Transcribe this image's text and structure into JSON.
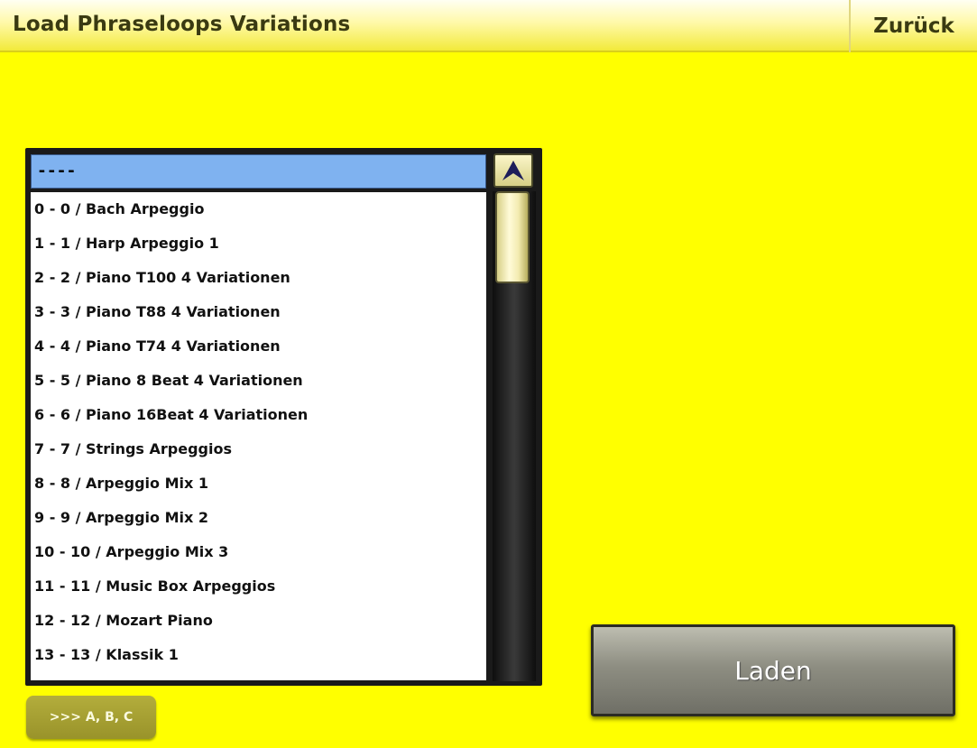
{
  "window": {
    "title": "Load Phraseloops Variations",
    "back_label": "Zurück"
  },
  "list": {
    "selected_value": "----",
    "items": [
      "0 - 0 / Bach Arpeggio",
      "1 - 1 / Harp Arpeggio 1",
      "2 - 2 / Piano T100 4 Variationen",
      "3 - 3 / Piano T88 4 Variationen",
      "4 - 4 / Piano T74 4 Variationen",
      "5 - 5 / Piano 8 Beat 4 Variationen",
      "6 - 6 / Piano 16Beat 4 Variationen",
      "7 - 7 / Strings Arpeggios",
      "8 - 8 / Arpeggio Mix 1",
      "9 - 9 / Arpeggio Mix 2",
      "10 - 10 / Arpeggio Mix 3",
      "11 - 11 / Music Box Arpeggios",
      "12 - 12 / Mozart Piano",
      "13 - 13 / Klassik 1"
    ],
    "scroll_up_icon": "arrow-up-icon"
  },
  "buttons": {
    "abc_label": ">>> A, B, C",
    "load_label": "Laden"
  },
  "colors": {
    "background": "#ffff00",
    "selection": "#7fb2f0"
  }
}
